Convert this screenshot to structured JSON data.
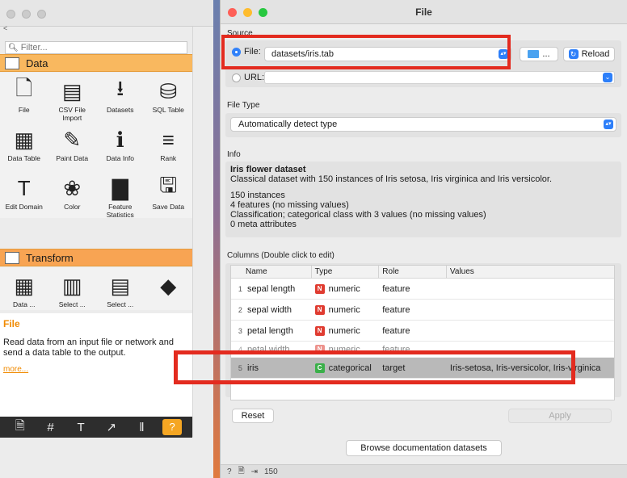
{
  "canvas": {
    "filter_placeholder": "Filter...",
    "categories": {
      "data": "Data",
      "transform": "Transform"
    },
    "data_widgets": [
      {
        "label": "File",
        "icon": "file-icon"
      },
      {
        "label": "CSV File Import",
        "icon": "csv-icon"
      },
      {
        "label": "Datasets",
        "icon": "datasets-icon"
      },
      {
        "label": "SQL Table",
        "icon": "database-icon"
      },
      {
        "label": "Data Table",
        "icon": "table-icon"
      },
      {
        "label": "Paint Data",
        "icon": "paint-icon"
      },
      {
        "label": "Data Info",
        "icon": "info-icon"
      },
      {
        "label": "Rank",
        "icon": "rank-icon"
      },
      {
        "label": "Edit Domain",
        "icon": "edit-domain-icon"
      },
      {
        "label": "Color",
        "icon": "palette-icon"
      },
      {
        "label": "Feature Statistics",
        "icon": "statistics-icon"
      },
      {
        "label": "Save Data",
        "icon": "save-icon"
      }
    ],
    "transform_widgets": [
      {
        "label": "Data ...",
        "icon": "data-sampler-icon"
      },
      {
        "label": "Select ...",
        "icon": "select-columns-icon"
      },
      {
        "label": "Select ...",
        "icon": "select-rows-icon"
      },
      {
        "label": "",
        "icon": "transpose-icon"
      }
    ],
    "help": {
      "title": "File",
      "body": "Read data from an input file or network and send a data table to the output.",
      "more": "more..."
    }
  },
  "window": {
    "title": "File"
  },
  "source": {
    "label": "Source",
    "file_label": "File:",
    "file_value": "datasets/iris.tab",
    "browse_label": "...",
    "reload_label": "Reload",
    "url_label": "URL:"
  },
  "file_type": {
    "label": "File Type",
    "value": "Automatically detect type"
  },
  "info": {
    "label": "Info",
    "title": "Iris flower dataset",
    "description": "Classical dataset with 150 instances of Iris setosa, Iris virginica and Iris versicolor.",
    "lines": [
      "150 instances",
      "4 features (no missing values)",
      "Classification; categorical class with 3 values (no missing values)",
      "0 meta attributes"
    ]
  },
  "columns": {
    "label": "Columns (Double click to edit)",
    "headers": [
      "Name",
      "Type",
      "Role",
      "Values"
    ],
    "rows": [
      {
        "idx": "1",
        "name": "sepal length",
        "badge": "N",
        "type": "numeric",
        "role": "feature",
        "values": ""
      },
      {
        "idx": "2",
        "name": "sepal width",
        "badge": "N",
        "type": "numeric",
        "role": "feature",
        "values": ""
      },
      {
        "idx": "3",
        "name": "petal length",
        "badge": "N",
        "type": "numeric",
        "role": "feature",
        "values": ""
      },
      {
        "idx": "4",
        "name": "petal width",
        "badge": "N",
        "type": "numeric",
        "role": "feature",
        "values": ""
      },
      {
        "idx": "5",
        "name": "iris",
        "badge": "C",
        "type": "categorical",
        "role": "target",
        "values": "Iris-setosa, Iris-versicolor, Iris-virginica"
      }
    ]
  },
  "buttons": {
    "reset": "Reset",
    "apply": "Apply",
    "docs": "Browse documentation datasets"
  },
  "status": {
    "count": "150"
  },
  "colors": {
    "highlight": "#e32b1f",
    "accent": "#2d7ff9",
    "category_data": "#f9b85f"
  }
}
